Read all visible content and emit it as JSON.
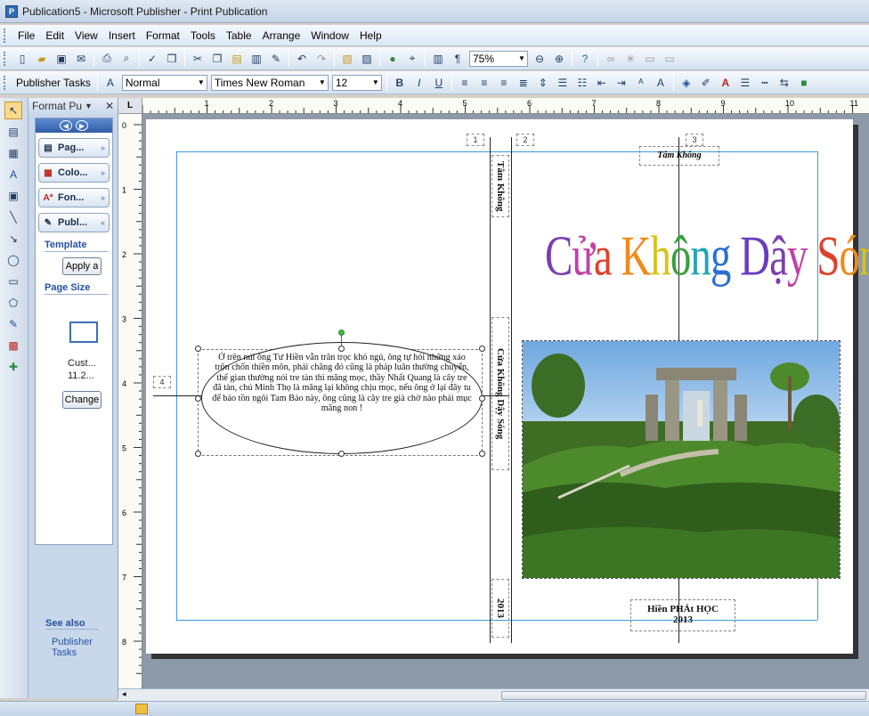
{
  "window": {
    "title": "Publication5 - Microsoft Publisher - Print Publication"
  },
  "menu": [
    "File",
    "Edit",
    "View",
    "Insert",
    "Format",
    "Tools",
    "Table",
    "Arrange",
    "Window",
    "Help"
  ],
  "toolbar": {
    "zoom": "75%"
  },
  "formatting": {
    "tasks_label": "Publisher Tasks",
    "style": "Normal",
    "font": "Times New Roman",
    "size": "12"
  },
  "taskpane": {
    "title": "Format Pu",
    "tabs": [
      "Pag...",
      "Colo...",
      "Fon...",
      "Publ..."
    ],
    "template_heading": "Template",
    "apply_button": "Apply a",
    "page_size_heading": "Page Size",
    "page_size_name": "Cust...",
    "page_size_dims": "11.2...",
    "change_button": "Change",
    "see_also": "See also",
    "publisher_tasks_link": "Publisher Tasks"
  },
  "ruler": {
    "h_labels": [
      "1",
      "2",
      "3",
      "4",
      "5",
      "6",
      "7",
      "8",
      "9",
      "10",
      "11"
    ],
    "v_labels": [
      "0",
      "1",
      "2",
      "3",
      "4",
      "5",
      "6",
      "7",
      "8"
    ]
  },
  "document": {
    "page_numbers": [
      "1",
      "2",
      "3",
      "4"
    ],
    "spine_top": "Tâm Không",
    "spine_mid": "Cửa Không Dậy Sóng",
    "spine_bottom": "2013",
    "title_wordart": "Cửa Không Dậy Sóng",
    "top_header": "Tâm Không",
    "ellipse_text": "Ở trên núi ông Tư Hiền vẫn trăn trọc khó ngủ, ông tự hỏi những xáo trộn chốn thiền môn, phải chăng đó cũng là pháp luân thường chuyển, thế gian thường nói tre tàn thì măng mọc, thầy Nhất Quang là cây tre đã tàn, chú Minh Thọ là măng lại không chịu mọc, nếu ông ở lại đây tu để bảo tồn ngôi Tam Bảo này, ông cũng là cây tre già chờ nào phải mục măng non !",
    "caption_line1": "Hiền PHÁt HỌC",
    "caption_line2": "2013",
    "wordart_colors": [
      "#7a3fb0",
      "#c33fa8",
      "#e0402a",
      "#f08a1a",
      "#d8c21a",
      "#36a13a",
      "#1fa6b8",
      "#2c6fd0",
      "#6a3cc0"
    ]
  }
}
